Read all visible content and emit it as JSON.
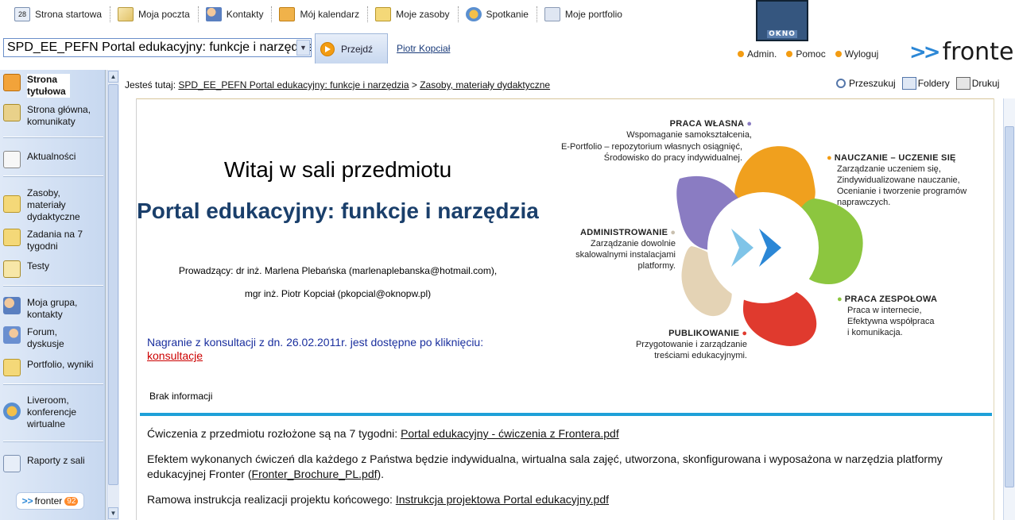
{
  "topnav": [
    {
      "label": "Strona startowa",
      "icon": "calendar-28-icon",
      "badge": "28"
    },
    {
      "label": "Moja poczta",
      "icon": "mail-icon"
    },
    {
      "label": "Kontakty",
      "icon": "contacts-icon"
    },
    {
      "label": "Mój kalendarz",
      "icon": "calendar-icon"
    },
    {
      "label": "Moje zasoby",
      "icon": "folder-icon"
    },
    {
      "label": "Spotkanie",
      "icon": "meeting-icon"
    },
    {
      "label": "Moje portfolio",
      "icon": "portfolio-icon"
    }
  ],
  "okno_logo": "OKNO",
  "room_select": {
    "value": "SPD_EE_PEFN Portal edukacyjny: funkcje i narzędzia"
  },
  "go_button": "Przejdź",
  "user_name": "Piotr Kopciał",
  "top_links": {
    "admin": "Admin.",
    "help": "Pomoc",
    "logout": "Wyloguj"
  },
  "brand": "fronter",
  "sidebar": {
    "items": [
      {
        "label": "Strona tytułowa",
        "icon": "title-page-icon",
        "active": true
      },
      {
        "label": "Strona główna, komunikaty",
        "icon": "home-icon"
      },
      {
        "label": "Aktualności",
        "icon": "news-icon"
      },
      {
        "label": "Zasoby, materiały dydaktyczne",
        "icon": "folder-icon"
      },
      {
        "label": "Zadania na 7 tygodni",
        "icon": "tasks-icon"
      },
      {
        "label": "Testy",
        "icon": "tests-icon"
      },
      {
        "label": "Moja grupa, kontakty",
        "icon": "group-icon"
      },
      {
        "label": "Forum, dyskusje",
        "icon": "forum-icon"
      },
      {
        "label": "Portfolio, wyniki",
        "icon": "portfolio-icon"
      },
      {
        "label": "Liveroom, konferencje wirtualne",
        "icon": "liveroom-icon"
      },
      {
        "label": "Raporty z sali",
        "icon": "reports-icon"
      }
    ],
    "footer_brand": "fronter",
    "footer_version": "92"
  },
  "breadcrumb": {
    "prefix": "Jesteś tutaj:",
    "level1": "SPD_EE_PEFN Portal edukacyjny: funkcje i narzędzia",
    "sep": ">",
    "level2": "Zasoby, materiały dydaktyczne"
  },
  "tools": {
    "search": "Przeszukuj",
    "folders": "Foldery",
    "print": "Drukuj"
  },
  "main": {
    "welcome": "Witaj w sali przedmiotu",
    "course_title": "Portal edukacyjny: funkcje i narzędzia",
    "lecturer1": "Prowadzący: dr inż. Marlena Plebańska (marlenaplebanska@hotmail.com),",
    "lecturer2": "mgr inż. Piotr Kopciał (pkopcial@oknopw.pl)",
    "notice_text": "Nagranie z konsultacji z dn. 26.02.2011r. jest dostępne po kliknięciu:",
    "notice_link": "konsultacje",
    "no_info": "Brak informacji",
    "p1_text": "Ćwiczenia z przedmiotu rozłożone są na 7 tygodni:",
    "p1_link": "Portal edukacyjny - ćwiczenia z Frontera.pdf",
    "p2_text": "Efektem wykonanych ćwiczeń dla każdego z Państwa będzie indywidualna, wirtualna sala zajęć, utworzona, skonfigurowana i wyposażona w narzędzia platformy edukacyjnej Fronter (",
    "p2_link": "Fronter_Brochure_PL.pdf",
    "p2_end": ").",
    "p3_text": "Ramowa instrukcja realizacji projektu końcowego:",
    "p3_link": "Instrukcja projektowa Portal edukacyjny.pdf"
  },
  "diagram": {
    "praca_wlasna_title": "PRACA WŁASNA",
    "praca_wlasna_l1": "Wspomaganie samokształcenia,",
    "praca_wlasna_l2": "E-Portfolio – repozytorium własnych osiągnięć,",
    "praca_wlasna_l3": "Środowisko do pracy indywidualnej.",
    "nauczanie_title": "NAUCZANIE – UCZENIE SIĘ",
    "nauczanie_l1": "Zarządzanie uczeniem się,",
    "nauczanie_l2": "Zindywidualizowane nauczanie,",
    "nauczanie_l3": "Ocenianie i tworzenie programów",
    "nauczanie_l4": "naprawczych.",
    "admin_title": "ADMINISTROWANIE",
    "admin_l1": "Zarządzanie dowolnie",
    "admin_l2": "skalowalnymi instalacjami",
    "admin_l3": "platformy.",
    "zespolowa_title": "PRACA ZESPOŁOWA",
    "zespolowa_l1": "Praca w internecie,",
    "zespolowa_l2": "Efektywna współpraca",
    "zespolowa_l3": "i komunikacja.",
    "publikowanie_title": "PUBLIKOWANIE",
    "publikowanie_l1": "Przygotowanie i zarządzanie",
    "publikowanie_l2": "treściami edukacyjnymi."
  },
  "colors": {
    "accent": "#1ea0d8",
    "orange": "#f39c12",
    "purple": "#8a7cc2",
    "green": "#8cc63f",
    "red": "#e03a2e",
    "link_blue": "#1a2f9e",
    "title_blue": "#1a3f6b"
  }
}
